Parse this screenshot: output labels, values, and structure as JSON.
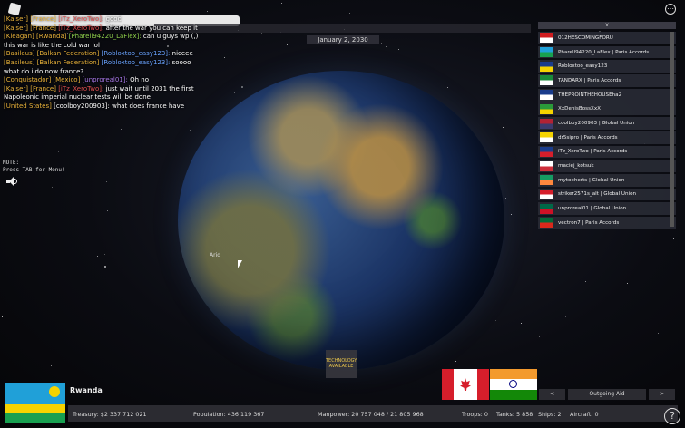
{
  "chat": [
    {
      "parts": [
        {
          "t": "[Kaiser] [France] ",
          "c": "tag"
        },
        {
          "t": "[iTz_XeroTwo]: ",
          "c": "tag-red"
        },
        {
          "t": "good",
          "c": "msg"
        }
      ]
    },
    {
      "parts": [
        {
          "t": "[Kaiser] [France] ",
          "c": "tag"
        },
        {
          "t": "[iTz_XeroTwo]: ",
          "c": "tag-red"
        },
        {
          "t": "after the war you can keep it",
          "c": "msg"
        }
      ]
    },
    {
      "parts": [
        {
          "t": "[Kleagan] [Rwanda] ",
          "c": "tag"
        },
        {
          "t": "[Pharell94220_LaFlex]: ",
          "c": "tag-green"
        },
        {
          "t": "can u guys wp (,)",
          "c": "msg"
        }
      ]
    },
    {
      "parts": [
        {
          "t": "this war is like the cold war lol",
          "c": "msg"
        }
      ]
    },
    {
      "parts": [
        {
          "t": "[Basileus] [Balkan Federation] ",
          "c": "tag"
        },
        {
          "t": "[Robloxtoo_easy123]: ",
          "c": "tag-blue"
        },
        {
          "t": "niceee",
          "c": "msg"
        }
      ]
    },
    {
      "parts": [
        {
          "t": "[Basileus] [Balkan Federation] ",
          "c": "tag"
        },
        {
          "t": "[Robloxtoo_easy123]: ",
          "c": "tag-blue"
        },
        {
          "t": "soooo",
          "c": "msg"
        }
      ]
    },
    {
      "parts": [
        {
          "t": "what do i do now france?",
          "c": "msg"
        }
      ]
    },
    {
      "parts": [
        {
          "t": "[Conquistador] [Mexico] ",
          "c": "tag"
        },
        {
          "t": "[unproreal01]: ",
          "c": "tag-purple"
        },
        {
          "t": "Oh no",
          "c": "msg"
        }
      ]
    },
    {
      "parts": [
        {
          "t": "[Kaiser] [France] ",
          "c": "tag"
        },
        {
          "t": "[iTz_XeroTwo]: ",
          "c": "tag-red"
        },
        {
          "t": "just wait until 2031 the first",
          "c": "msg"
        }
      ]
    },
    {
      "parts": [
        {
          "t": "Napoleonic imperial nuclear tests will be done",
          "c": "msg"
        }
      ]
    },
    {
      "parts": [
        {
          "t": "[United States] ",
          "c": "tag"
        },
        {
          "t": "[coolboy200903]: ",
          "c": "msg"
        },
        {
          "t": "what does france have",
          "c": "msg"
        }
      ]
    }
  ],
  "date": "January 2, 2030",
  "note": {
    "line1": "NOTE:",
    "line2": "Press TAB for Menu!"
  },
  "globe_label": "Arid",
  "player_list_header": "v",
  "players": [
    {
      "name": "012HESCOMINGFORU",
      "flag": [
        "#d01c1f",
        "#ffffff"
      ]
    },
    {
      "name": "Pharell94220_LaFlex | Paris Accords",
      "flag": [
        "#20a0d8",
        "#18a050"
      ]
    },
    {
      "name": "Robloxtoo_easy123",
      "flag": [
        "#1a3c8c",
        "#f5d300"
      ]
    },
    {
      "name": "TANDARX | Paris Accords",
      "flag": [
        "#1a8a3a",
        "#ffffff"
      ]
    },
    {
      "name": "THEPROINTHEHOUSEha2",
      "flag": [
        "#1a3c8c",
        "#ffffff"
      ]
    },
    {
      "name": "XxDenisBossXxX",
      "flag": [
        "#2a9a3a",
        "#f5d300"
      ]
    },
    {
      "name": "coolboy200903 | Global Union",
      "flag": [
        "#b22234",
        "#3c3b6e"
      ]
    },
    {
      "name": "dr5sipro | Paris Accords",
      "flag": [
        "#f5d300",
        "#ffffff"
      ]
    },
    {
      "name": "iTz_XeroTwo | Paris Accords",
      "flag": [
        "#1a3c8c",
        "#d61e2b"
      ]
    },
    {
      "name": "maciej_kotsuk",
      "flag": [
        "#ffffff",
        "#cd2e3a"
      ]
    },
    {
      "name": "mytoeherts | Global Union",
      "flag": [
        "#169b62",
        "#ff883e"
      ]
    },
    {
      "name": "striker2571s_alt | Global Union",
      "flag": [
        "#d61e2b",
        "#ffffff"
      ]
    },
    {
      "name": "unproreal01 | Global Union",
      "flag": [
        "#006847",
        "#ce1126"
      ]
    },
    {
      "name": "vectron7 | Paris Accords",
      "flag": [
        "#046a38",
        "#da291c"
      ]
    }
  ],
  "tech_button": {
    "line1": "TECHNOLOGY",
    "line2": "AVAILABLE"
  },
  "country": {
    "name": "Rwanda"
  },
  "stats": {
    "treasury": "Treasury:  $2 337 712 021",
    "population": "Population: 436 119 367",
    "manpower": "Manpower:  20 757 048  /  21 805 968",
    "troops": "Troops: 0",
    "tanks": "Tanks: 5 858",
    "ships": "Ships: 2",
    "aircraft": "Aircraft: 0"
  },
  "aid": {
    "prev": "<",
    "label": "Outgoing Aid",
    "next": ">"
  },
  "help": "?",
  "menu": "⋯"
}
